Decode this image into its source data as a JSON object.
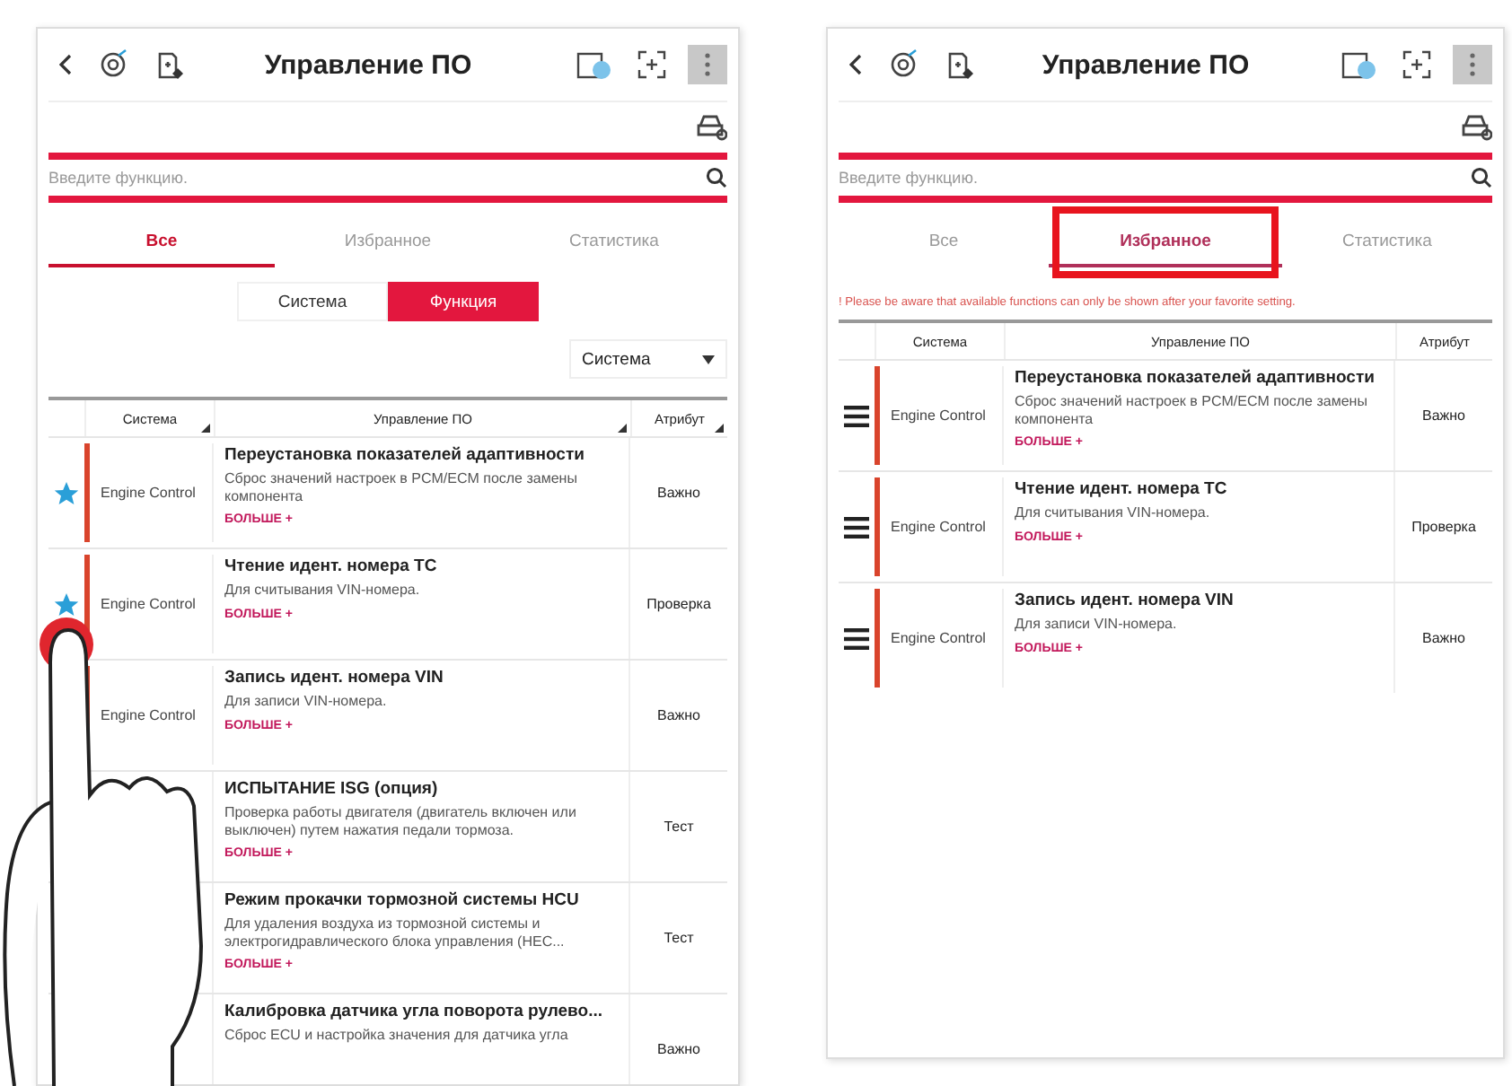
{
  "screens": [
    {
      "title": "Управление ПО",
      "search": {
        "placeholder": "Введите функцию."
      },
      "tabs": [
        {
          "label": "Все",
          "selected": true,
          "highlighted": false
        },
        {
          "label": "Избранное",
          "selected": false,
          "highlighted": false
        },
        {
          "label": "Статистика",
          "selected": false,
          "highlighted": false
        }
      ],
      "segments": [
        {
          "label": "Система",
          "selected": false
        },
        {
          "label": "Функция",
          "selected": true
        }
      ],
      "dropdown": {
        "value": "Система"
      },
      "columns": [
        {
          "label": "Система",
          "sortable": true
        },
        {
          "label": "Управление ПО",
          "sortable": true
        },
        {
          "label": "Атрибут",
          "sortable": true
        }
      ],
      "rows": [
        {
          "kind": "star",
          "favorite": true,
          "system": "Engine Control",
          "title": "Переустановка показателей адаптивности",
          "description": "Сброс значений настроек в PCM/ECM после замены компонента",
          "more": "БОЛЬШЕ +",
          "attribute": "Важно"
        },
        {
          "kind": "star",
          "favorite": true,
          "system": "Engine Control",
          "title": "Чтение идент. номера ТС",
          "description": "Для считывания VIN-номера.",
          "more": "БОЛЬШЕ +",
          "attribute": "Проверка"
        },
        {
          "system": "Engine Control",
          "title": "Запись идент. номера VIN",
          "description": "Для записи VIN-номера.",
          "more": "БОЛЬШЕ +",
          "attribute": "Важно"
        },
        {
          "title": "ИСПЫТАНИЕ ISG (опция)",
          "description": "Проверка работы двигателя (двигатель включен или выключен) путем нажатия педали тормоза.",
          "more": "БОЛЬШЕ +",
          "attribute": "Тест"
        },
        {
          "title": "Режим прокачки тормозной системы HCU",
          "description": "Для удаления воздуха из тормозной системы и электрогидравлического блока управления (HEC...",
          "more": "БОЛЬШЕ +",
          "attribute": "Тест"
        },
        {
          "title": "Калибровка датчика угла поворота рулево...",
          "description": "Сброс ECU и настройка значения для датчика угла",
          "attribute": "Важно"
        }
      ]
    },
    {
      "title": "Управление ПО",
      "search": {
        "placeholder": "Введите функцию."
      },
      "tabs": [
        {
          "label": "Все",
          "selected": false,
          "highlighted": false
        },
        {
          "label": "Избранное",
          "selected": true,
          "highlighted": true
        },
        {
          "label": "Статистика",
          "selected": false,
          "highlighted": false
        }
      ],
      "notice": "! Please be aware that available functions can only be shown after your favorite setting.",
      "columns": [
        {
          "label": "Система",
          "sortable": false
        },
        {
          "label": "Управление ПО",
          "sortable": false
        },
        {
          "label": "Атрибут",
          "sortable": false
        }
      ],
      "rows": [
        {
          "kind": "drag",
          "system": "Engine Control",
          "title": "Переустановка показателей адаптивности",
          "description": "Сброс значений настроек в PCM/ECM после замены компонента",
          "more": "БОЛЬШЕ +",
          "attribute": "Важно"
        },
        {
          "kind": "drag",
          "system": "Engine Control",
          "title": "Чтение идент. номера ТС",
          "description": "Для считывания VIN-номера.",
          "more": "БОЛЬШЕ +",
          "attribute": "Проверка"
        },
        {
          "kind": "drag",
          "system": "Engine Control",
          "title": "Запись идент. номера VIN",
          "description": "Для записи VIN-номера.",
          "more": "БОЛЬШЕ +",
          "attribute": "Важно"
        }
      ]
    }
  ]
}
